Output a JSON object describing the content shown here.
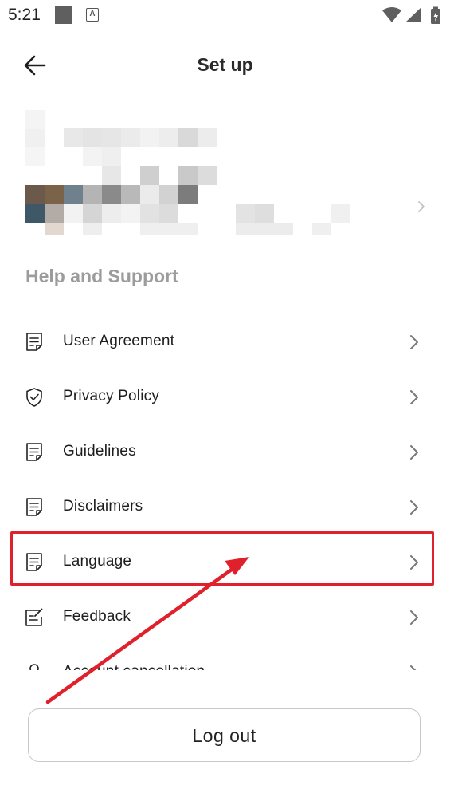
{
  "status_bar": {
    "time": "5:21"
  },
  "header": {
    "title": "Set up"
  },
  "section": {
    "title": "Help and Support"
  },
  "menu": {
    "items": [
      {
        "label": "User Agreement",
        "icon": "document-icon"
      },
      {
        "label": "Privacy Policy",
        "icon": "shield-check-icon"
      },
      {
        "label": "Guidelines",
        "icon": "document-icon"
      },
      {
        "label": "Disclaimers",
        "icon": "document-icon"
      },
      {
        "label": "Language",
        "icon": "document-icon"
      },
      {
        "label": "Feedback",
        "icon": "edit-note-icon"
      },
      {
        "label": "Account cancellation",
        "icon": "user-icon"
      }
    ]
  },
  "logout": {
    "label": "Log out"
  },
  "annotation": {
    "highlight_color": "#e0202a",
    "highlighted_item": "Language"
  }
}
